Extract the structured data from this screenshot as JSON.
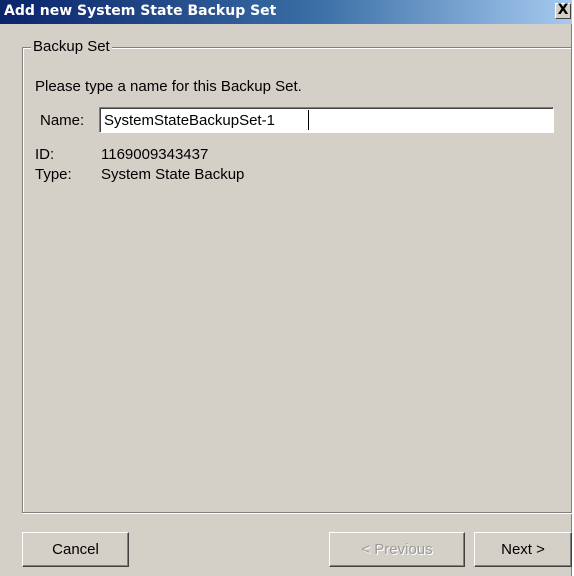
{
  "window": {
    "title": "Add new  System State Backup Set",
    "close_symbol": "X"
  },
  "group": {
    "legend": "Backup Set",
    "instruction": "Please type a name for this Backup Set.",
    "name_label": "Name:",
    "name_value": "SystemStateBackupSet-1",
    "id_label": "ID:",
    "id_value": "1169009343437",
    "type_label": "Type:",
    "type_value": "System State Backup"
  },
  "buttons": {
    "cancel": "Cancel",
    "previous": "< Previous",
    "next": "Next >"
  }
}
